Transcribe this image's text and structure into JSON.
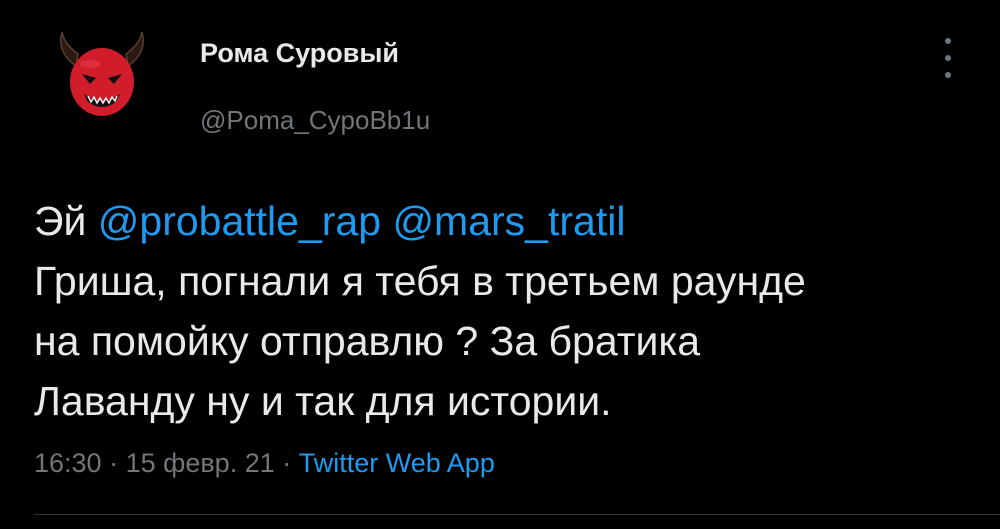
{
  "user": {
    "display_name": "Рома Суровый",
    "handle": "@Poma_CypoBb1u"
  },
  "tweet": {
    "word_1": "Эй",
    "mention_1": "@probattle_rap",
    "mention_2": "@mars_tratil",
    "line_2": "Гриша, погнали я тебя в третьем раунде",
    "line_3": "на помойку отправлю ? За братика",
    "line_4": "Лаванду ну и так для истории."
  },
  "meta": {
    "time": "16:30",
    "sep_1": " · ",
    "date": "15 февр. 21",
    "sep_2": " · ",
    "source": "Twitter Web App"
  },
  "icons": {
    "avatar": "red-devil-avatar-icon",
    "more": "more-vertical-icon"
  },
  "colors": {
    "background": "#000000",
    "text": "#e7e9ea",
    "secondary": "#71767b",
    "link": "#1d9bf0",
    "avatar_red": "#d01c2b"
  }
}
